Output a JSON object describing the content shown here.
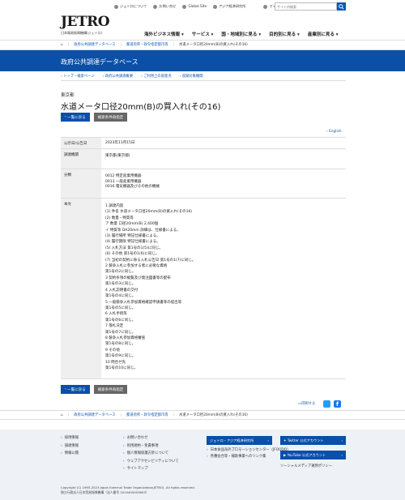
{
  "header": {
    "logo_main": "JETRO",
    "logo_sub": "日本貿易振興機構(ジェトロ)",
    "top_links": [
      "ジェトロについて",
      "お問い合せ",
      "Global Site",
      "アジア経済研究所",
      "マイページ"
    ],
    "search_placeholder": "サイト内検索",
    "nav": [
      "海外ビジネス情報",
      "サービス",
      "国・地域別に見る",
      "目的別に見る",
      "産業別に見る"
    ]
  },
  "breadcrumb": {
    "items": [
      "政府公共調達データベース",
      "都道府県・政令指定都市等",
      "水道メータ口径20mm(B)の買入れ(その16)"
    ]
  },
  "banner": {
    "title": "政府公共調達データベース"
  },
  "subnav": [
    "トップ・検索ページ",
    "政府公共調達概要",
    "ご利用上の留意点",
    "収録対象機関"
  ],
  "page": {
    "prefecture": "東京都",
    "title": "水道メータ口径20mm(B)の買入れ(その16)",
    "back_label": "一覧に戻る",
    "new_search_label": "検索条件再指定",
    "english": "English"
  },
  "table": {
    "rows": [
      {
        "key": "公示日/公告日",
        "lines": [
          "2023年11月15日"
        ]
      },
      {
        "key": "調達機関",
        "lines": [
          "東京都(東京都)"
        ]
      },
      {
        "key": "分類",
        "lines": [
          "0012 特定産業用機器",
          "0013 一般産業用機器",
          "0016 電気機器及びその他の機械"
        ]
      },
      {
        "key": "本文",
        "lines": [
          "1 調達内容",
          "(1) 件名 水道メータ口径20mm(B)の買入れ(その16)",
          "(2) 数量・特質等",
          "ア 数量 口径20mm(B) 2,400個",
          "イ 特質等 DA20mm 詳細は、仕様書による。",
          "(3) 履行場所 特記仕様書による。",
          "(4) 履行期限 特記仕様書による。",
          "(5) 入札方法 第1号の1(5)に同じ。",
          "(6) その他 第1号の1(6)に同じ。",
          "(7) 当初の契約に係る入札公告日 第1号の1(7)に同じ。",
          "2 競争入札に参加する者に必要な資格",
          "第1号の2に同じ。",
          "3 契約条項の縦覧及び発注図書等の配布",
          "第1号の3に同じ。",
          "4 入札説明書の交付",
          "第1号の4に同じ。",
          "5 一般競争入札参加資格確認申請書等の提出等",
          "第1号の5に同じ。",
          "6 入札手続等",
          "第1号の6に同じ。",
          "7 落札決定",
          "第1号の7に同じ。",
          "8 競争入札参加資格審査",
          "第1号の8に同じ。",
          "9 その他",
          "第1号の9に同じ。",
          "10 問合せ先",
          "第1号の10に同じ。"
        ]
      }
    ]
  },
  "share": {
    "print": "印刷する"
  },
  "footer": {
    "col1": [
      "採用情報",
      "調達情報",
      "情報公開"
    ],
    "col2": [
      "お問い合わせ",
      "利用規約・免責事項",
      "個人情報保護方針について",
      "ウェブアクセシビリティについて",
      "サイトマップ"
    ],
    "col3_btn": "ジェトロ・アジア経済研究所",
    "col3_links": [
      "日本食品海外プロモーションセンター（JFOODO）",
      "各種会合等・補助事業へのリンク集"
    ],
    "col4_btns": [
      "Twitter 公式アカウント",
      "YouTube 公式アカウント"
    ],
    "col4_link": "ソーシャルメディア運用ポリシー",
    "copyright": "Copyright (C) 1995-2023 Japan External Trade Organization(JETRO). All rights reserved.",
    "corp": "独立行政法人日本貿易振興機構（法人番号 2010405003693）"
  }
}
